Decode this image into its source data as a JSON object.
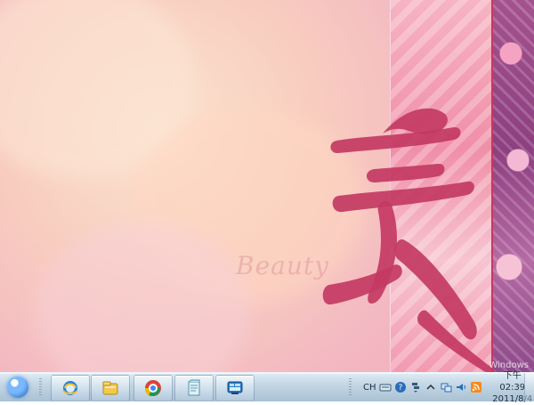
{
  "desktop": {
    "wallpaper_caption": "Beauty",
    "watermark": "Windows"
  },
  "taskbar": {
    "pinned_items": [
      {
        "icon": "internet-explorer-icon"
      },
      {
        "icon": "windows-explorer-icon"
      },
      {
        "icon": "google-chrome-icon"
      },
      {
        "icon": "notepad-icon"
      },
      {
        "icon": "control-panel-icon"
      }
    ],
    "tray": {
      "language": "CH",
      "time": "下午 02:39",
      "date": "2011/8/4"
    }
  },
  "colors": {
    "calligraphy": "#c33a63",
    "taskbar_top": "#dcebf5",
    "taskbar_bottom": "#a5bed2"
  }
}
